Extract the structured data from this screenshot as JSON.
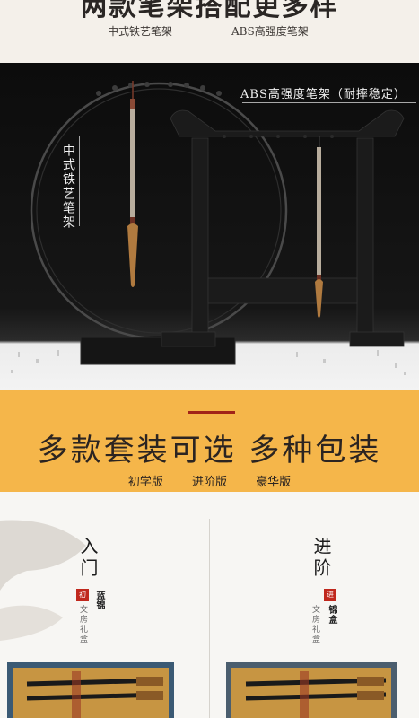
{
  "top": {
    "title": "两款笔架搭配更多样",
    "option_left": "中式铁艺笔架",
    "option_right": "ABS高强度笔架"
  },
  "photo": {
    "label_abs": "ABS高强度笔架（耐摔稳定）",
    "label_iron": "中式铁艺笔架"
  },
  "banner": {
    "title": "多款套装可选 多种包装",
    "options": [
      "初学版",
      "进阶版",
      "豪华版"
    ]
  },
  "packs": {
    "left": {
      "title": "入门",
      "caption": "文房礼盒",
      "seal": "初",
      "box": "蓝锦"
    },
    "right": {
      "title": "进阶",
      "caption": "文房礼盒",
      "seal": "进",
      "box": "锦盒"
    }
  },
  "colors": {
    "banner": "#f5b64a",
    "accent_red": "#a12318",
    "seal_red": "#c0281d"
  }
}
